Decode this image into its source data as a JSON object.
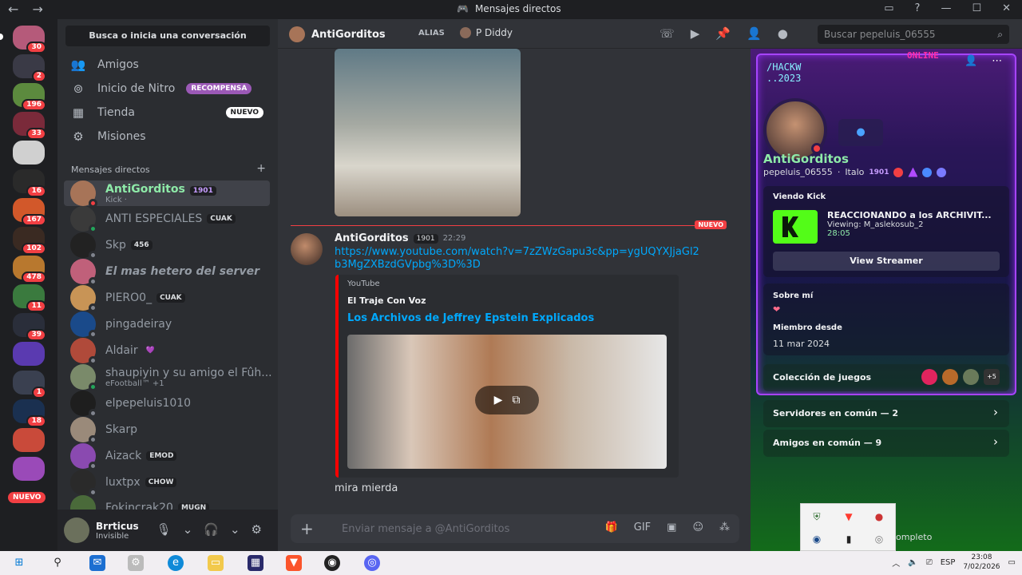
{
  "window": {
    "title": "Mensajes directos",
    "back_icon": "←",
    "forward_icon": "→"
  },
  "sidebar": {
    "search_label": "Busca o inicia una conversación",
    "nav": [
      {
        "label": "Amigos",
        "icon": "friends-icon"
      },
      {
        "label": "Inicio de Nitro",
        "icon": "nitro-icon",
        "tag": "RECOMPENSA"
      },
      {
        "label": "Tienda",
        "icon": "shop-icon",
        "tag": "NUEVO"
      },
      {
        "label": "Misiones",
        "icon": "quests-icon"
      }
    ],
    "dm_header": "Mensajes directos",
    "dm_add": "+",
    "dms": [
      {
        "name": "AntiGorditos",
        "tag": "1901",
        "sub": "Kick ·"
      },
      {
        "name": "ANTI ESPECIALES",
        "tag": "CUAK"
      },
      {
        "name": "Skp",
        "tag": "456"
      },
      {
        "name": "El mas hetero del server"
      },
      {
        "name": "PIERO0_",
        "tag": "CUAK"
      },
      {
        "name": "pingadeiray"
      },
      {
        "name": "Aldair",
        "tag": "💜"
      },
      {
        "name": "shaupiyin y su amigo el Fûh...",
        "sub": "eFootball™ +1"
      },
      {
        "name": "elpepeluis1010"
      },
      {
        "name": "Skarp"
      },
      {
        "name": "Aizack",
        "tag": "EMOD"
      },
      {
        "name": "luxtpx",
        "tag": "CHOW"
      },
      {
        "name": "Fokincrak20",
        "tag": "MUGN"
      }
    ]
  },
  "rail": {
    "badges": [
      "30",
      "2",
      "196",
      "33",
      "16",
      "167",
      "102",
      "478",
      "11",
      "39",
      "1",
      "18"
    ],
    "nuevo": "NUEVO"
  },
  "user": {
    "name": "Brrticus",
    "status": "Invisible"
  },
  "chat_header": {
    "name": "AntiGorditos",
    "alias_label": "ALIAS",
    "alias_value": "P Diddy",
    "search_placeholder": "Buscar pepeluis_06555"
  },
  "messages": {
    "new_label": "NUEVO",
    "author": "AntiGorditos",
    "level": "1901",
    "time": "22:29",
    "link": "https://www.youtube.com/watch?v=7zZWzGapu3c&pp=ygUQYXJjaGl2b3MgZXBzdGVpbg%3D%3D",
    "embed": {
      "provider": "YouTube",
      "author": "El Traje Con Voz",
      "title": "Los Archivos de Jeffrey Epstein Explicados"
    },
    "text": "mira mierda"
  },
  "composer": {
    "placeholder": "Enviar mensaje a @AntiGorditos"
  },
  "profile": {
    "banner_text_1": "/HACKW",
    "banner_text_2": "..2023",
    "banner_online": "ONLINE",
    "display_name": "AntiGorditos",
    "username": "pepeluis_06555",
    "pronoun": "Italo",
    "level": "1901",
    "activity_label": "Viendo Kick",
    "activity_title": "REACCIONANDO a los ARCHIVIT...",
    "activity_viewing": "Viewing: M_aslekosub_2",
    "activity_time": "28:05",
    "view_streamer": "View Streamer",
    "about_label": "Sobre mí",
    "about_text": "❤",
    "member_since_label": "Miembro desde",
    "member_since": "11 mar 2024",
    "games_label": "Colección de juegos",
    "games_more": "+5",
    "servers_common": "Servidores en común — 2",
    "friends_common": "Amigos en común — 9"
  },
  "tray": {
    "partial_text": "ompleto"
  },
  "taskbar": {
    "lang": "ESP",
    "time": "23:08",
    "date": "7/02/2026"
  },
  "colors": {
    "accent": "#5865f2",
    "red": "#f23f43",
    "link": "#00a8fc",
    "kick": "#53fc18"
  }
}
